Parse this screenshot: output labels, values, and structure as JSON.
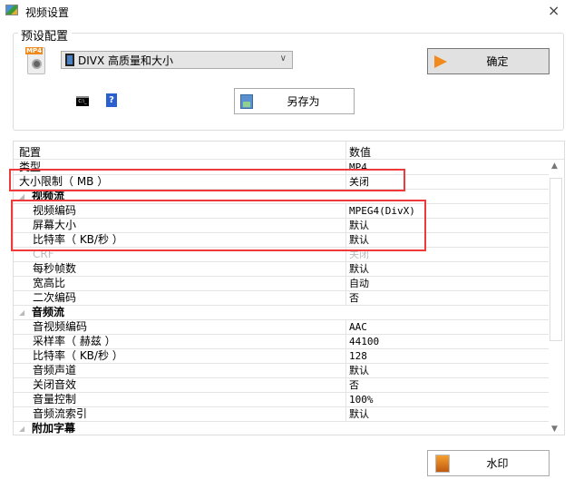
{
  "window": {
    "title": "视频设置",
    "close": "×"
  },
  "preset": {
    "group_label": "预设配置",
    "selected": "DIVX 高质量和大小",
    "confirm": "确定",
    "save_as": "另存为",
    "cmd_icon_text": "C:\\_",
    "help": "?"
  },
  "table": {
    "headers": [
      "配置",
      "数值"
    ],
    "rows": [
      {
        "k": "类型",
        "v": "MP4",
        "t": "item"
      },
      {
        "k": "大小限制（ MB ）",
        "v": "关闭",
        "t": "item"
      },
      {
        "k": "视频流",
        "v": "",
        "t": "cat"
      },
      {
        "k": "视频编码",
        "v": "MPEG4(DivX)",
        "t": "sub"
      },
      {
        "k": "屏幕大小",
        "v": "默认",
        "t": "sub"
      },
      {
        "k": "比特率（ KB/秒 ）",
        "v": "默认",
        "t": "sub"
      },
      {
        "k": "CRF",
        "v": "关闭",
        "t": "dis"
      },
      {
        "k": "每秒帧数",
        "v": "默认",
        "t": "sub"
      },
      {
        "k": "宽高比",
        "v": "自动",
        "t": "sub"
      },
      {
        "k": "二次编码",
        "v": "否",
        "t": "sub"
      },
      {
        "k": "音频流",
        "v": "",
        "t": "cat"
      },
      {
        "k": "音视频编码",
        "v": "AAC",
        "t": "sub"
      },
      {
        "k": "采样率（ 赫兹 ）",
        "v": "44100",
        "t": "sub"
      },
      {
        "k": "比特率（ KB/秒 ）",
        "v": "128",
        "t": "sub"
      },
      {
        "k": "音频声道",
        "v": "默认",
        "t": "sub"
      },
      {
        "k": "关闭音效",
        "v": "否",
        "t": "sub"
      },
      {
        "k": "音量控制",
        "v": "100%",
        "t": "sub"
      },
      {
        "k": "音频流索引",
        "v": "默认",
        "t": "sub"
      },
      {
        "k": "附加字幕",
        "v": "",
        "t": "cat"
      }
    ]
  },
  "watermark": "水印",
  "colors": {
    "highlight": "#f03a3a",
    "accent": "#f08a1c"
  }
}
